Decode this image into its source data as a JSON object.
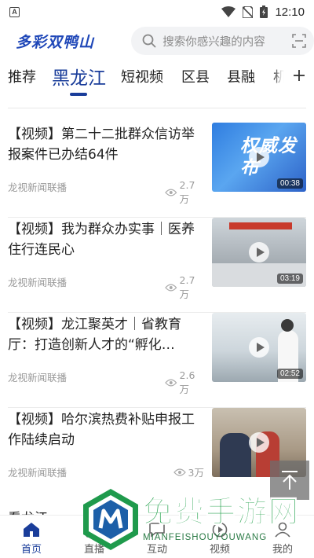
{
  "status_bar": {
    "time": "12:10",
    "notification_letter": "A"
  },
  "header": {
    "logo": "多彩双鸭山",
    "search_placeholder": "搜索你感兴趣的内容"
  },
  "tabs": [
    {
      "label": "推荐",
      "active": false
    },
    {
      "label": "黑龙江",
      "active": true
    },
    {
      "label": "短视频",
      "active": false
    },
    {
      "label": "区县",
      "active": false
    },
    {
      "label": "县融",
      "active": false
    },
    {
      "label": "机",
      "active": false
    }
  ],
  "colors": {
    "accent": "#1a3d9a",
    "logo": "#1f47b8",
    "watermark": "#21a04a"
  },
  "news": [
    {
      "title": "【视频】第二十二批群众信访举报案件已办结64件",
      "source": "龙视新闻联播",
      "views": "2.7万",
      "duration": "00:38",
      "thumb_text": "权威发布"
    },
    {
      "title": "【视频】我为群众办实事｜医养住行连民心",
      "source": "龙视新闻联播",
      "views": "2.7万",
      "duration": "03:19"
    },
    {
      "title": "【视频】龙江聚英才｜省教育厅：打造创新人才的“孵化…",
      "source": "龙视新闻联播",
      "views": "2.6万",
      "duration": "02:52"
    },
    {
      "title": "【视频】哈尔滨热费补贴申报工作陆续启动",
      "source": "龙视新闻联播",
      "views": "3万",
      "duration": ""
    }
  ],
  "section_peek": "看龙江",
  "bottom_nav": [
    {
      "label": "首页",
      "icon": "home-icon",
      "active": true
    },
    {
      "label": "直播",
      "icon": "live-icon",
      "active": false
    },
    {
      "label": "互动",
      "icon": "interact-icon",
      "active": false
    },
    {
      "label": "视频",
      "icon": "video-icon",
      "active": false
    },
    {
      "label": "我的",
      "icon": "profile-icon",
      "active": false
    }
  ],
  "watermark": {
    "title": "免费手游网",
    "subtitle": "MIANFEISHOUYOUWANG"
  }
}
